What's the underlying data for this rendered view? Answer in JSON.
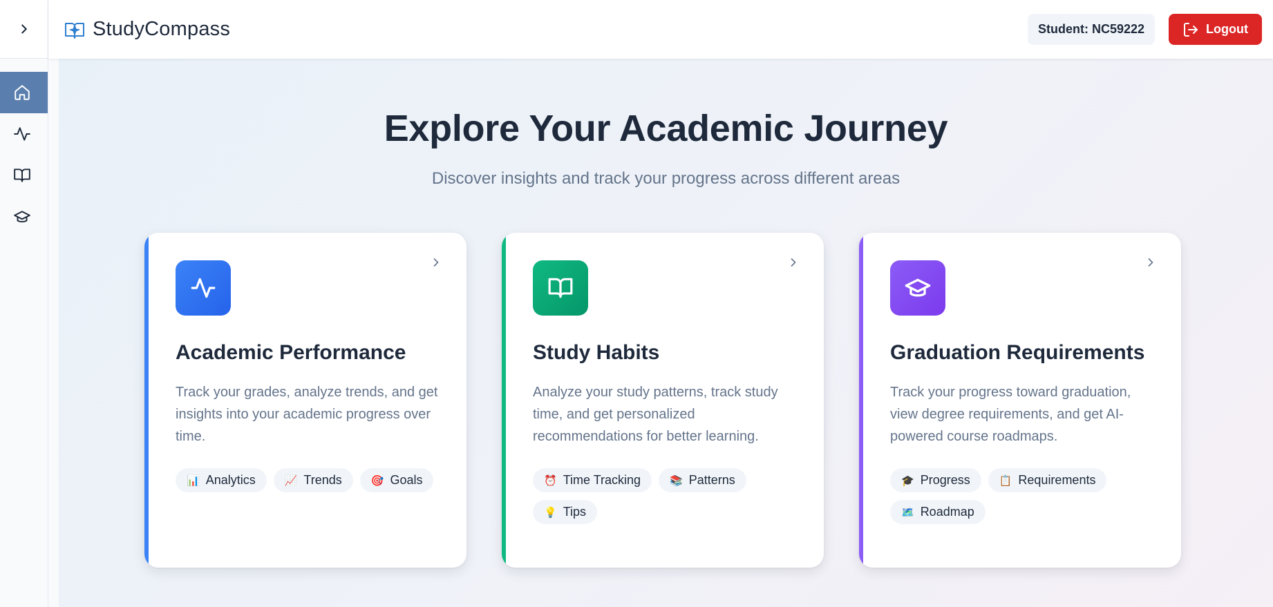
{
  "app": {
    "name": "StudyCompass"
  },
  "header": {
    "student_label": "Student: NC59222",
    "logout_label": "Logout"
  },
  "sidebar": {
    "items": [
      {
        "icon": "home-icon",
        "active": true
      },
      {
        "icon": "activity-icon",
        "active": false
      },
      {
        "icon": "book-open-icon",
        "active": false
      },
      {
        "icon": "graduation-cap-icon",
        "active": false
      }
    ]
  },
  "hero": {
    "title": "Explore Your Academic Journey",
    "subtitle": "Discover insights and track your progress across different areas"
  },
  "cards": [
    {
      "title": "Academic Performance",
      "description": "Track your grades, analyze trends, and get insights into your academic progress over time.",
      "accent": "#3b82f6",
      "icon": "activity-icon",
      "tags": [
        {
          "emoji": "📊",
          "label": "Analytics"
        },
        {
          "emoji": "📈",
          "label": "Trends"
        },
        {
          "emoji": "🎯",
          "label": "Goals"
        }
      ]
    },
    {
      "title": "Study Habits",
      "description": "Analyze your study patterns, track study time, and get personalized recommendations for better learning.",
      "accent": "#10b981",
      "icon": "book-open-icon",
      "tags": [
        {
          "emoji": "⏰",
          "label": "Time Tracking"
        },
        {
          "emoji": "📚",
          "label": "Patterns"
        },
        {
          "emoji": "💡",
          "label": "Tips"
        }
      ]
    },
    {
      "title": "Graduation Requirements",
      "description": "Track your progress toward graduation, view degree requirements, and get AI-powered course roadmaps.",
      "accent": "#8b5cf6",
      "icon": "graduation-cap-icon",
      "tags": [
        {
          "emoji": "🎓",
          "label": "Progress"
        },
        {
          "emoji": "📋",
          "label": "Requirements"
        },
        {
          "emoji": "🗺️",
          "label": "Roadmap"
        }
      ]
    }
  ]
}
